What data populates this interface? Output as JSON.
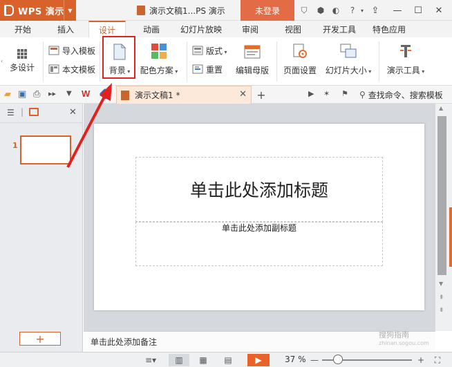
{
  "titlebar": {
    "app_name": "WPS 演示",
    "doc_title": "演示文稿1...PS 演示",
    "login_label": "未登录"
  },
  "tabs": [
    "开始",
    "插入",
    "设计",
    "动画",
    "幻灯片放映",
    "审阅",
    "视图",
    "开发工具",
    "特色应用"
  ],
  "active_tab": "设计",
  "ribbon": {
    "multi_design": "多设计",
    "import_template": "导入模板",
    "this_template": "本文模板",
    "background": "背景",
    "color_scheme": "配色方案",
    "layout": "版式",
    "reset": "重置",
    "edit_master": "编辑母版",
    "page_setup": "页面设置",
    "slide_size": "幻灯片大小",
    "presentation_tools": "演示工具"
  },
  "quickbar": {
    "doc_tab_label": "演示文稿1 *",
    "search_label": "查找命令、搜索模板"
  },
  "slide": {
    "title_placeholder": "单击此处添加标题",
    "subtitle_placeholder": "单击此处添加副标题",
    "number": "1"
  },
  "notes_placeholder": "单击此处添加备注",
  "watermark": {
    "text": "搜狗指南",
    "url": "zhinan.sogou.com"
  },
  "status": {
    "zoom": "37 %"
  },
  "colors": {
    "accent": "#d9622b",
    "annotation_red": "#e2201e"
  }
}
